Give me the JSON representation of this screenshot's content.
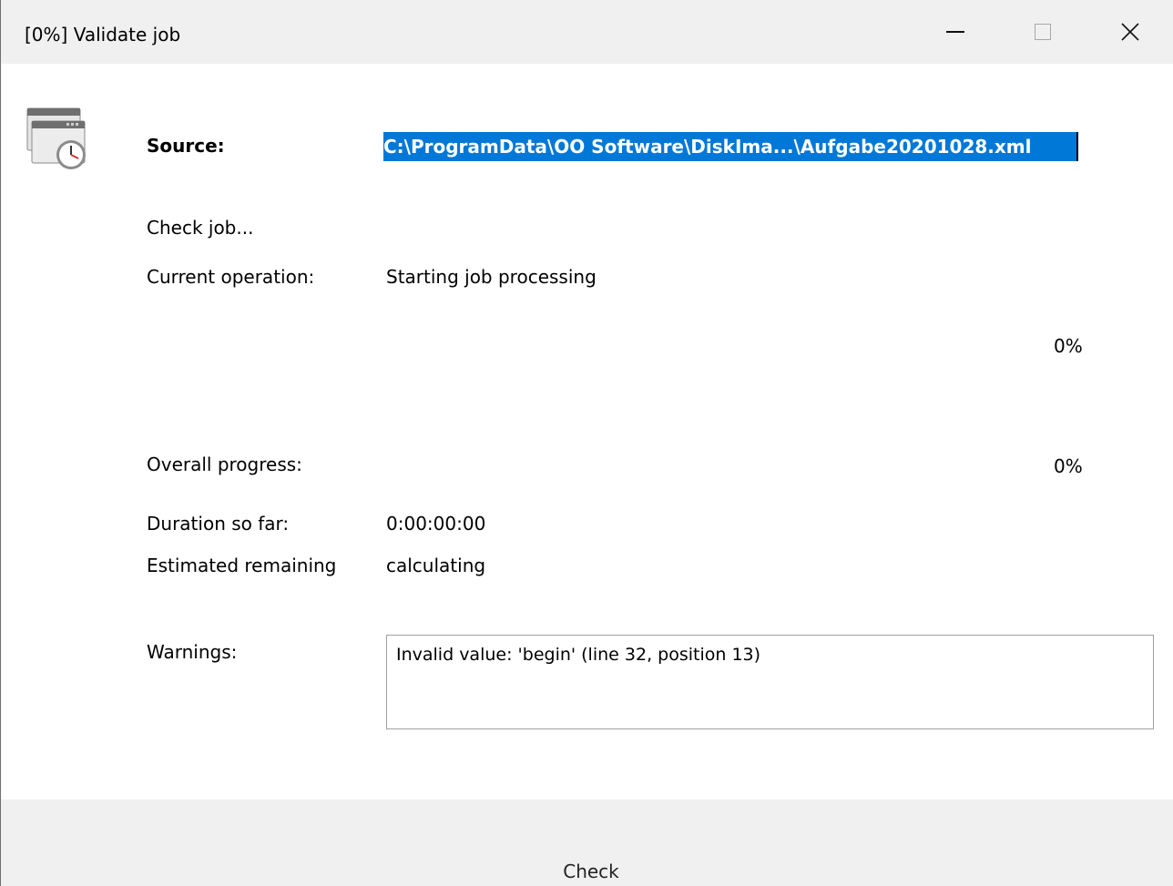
{
  "window": {
    "title": "[0%] Validate job",
    "icons": {
      "minimize": "minimize-icon",
      "maximize": "maximize-icon",
      "close": "close-icon",
      "app": "scheduled-job-icon"
    }
  },
  "source": {
    "label": "Source:",
    "value": "C:\\ProgramData\\OO Software\\DiskIma...\\Aufgabe20201028.xml"
  },
  "status": "Check job...",
  "current_operation": {
    "label": "Current operation:",
    "value": "Starting job processing",
    "percent": "0%"
  },
  "overall_progress": {
    "label": "Overall progress:",
    "percent": "0%"
  },
  "duration": {
    "label": "Duration so far:",
    "value": "0:00:00:00"
  },
  "estimated": {
    "label": "Estimated remaining",
    "value": "calculating"
  },
  "warnings": {
    "label": "Warnings:",
    "text": "Invalid value: 'begin' (line 32, position 13)"
  },
  "footer": {
    "check_label": "Check"
  },
  "colors": {
    "selection": "#0078d7",
    "titlebar": "#f0f0f0"
  }
}
